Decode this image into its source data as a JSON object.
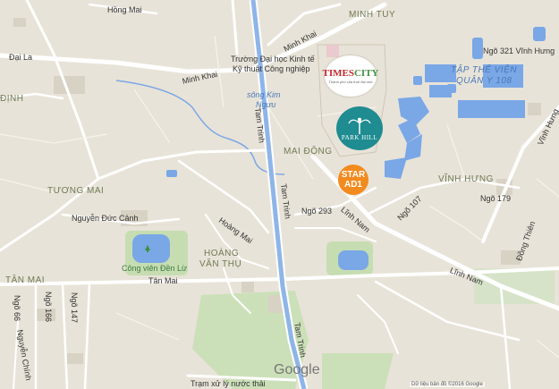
{
  "map": {
    "road_labels": {
      "hong_mai": "Hồng Mai",
      "dai_la": "Đại La",
      "minh_khai_1": "Minh Khai",
      "minh_khai_2": "Minh Khai",
      "university_line1": "Trường Đại học Kinh tế",
      "university_line2": "Kỹ thuật Công nghiệp",
      "tam_trinh_top": "Tam Trinh",
      "tam_trinh_mid": "Tam Trinh",
      "tam_trinh_bottom": "Tam Trinh",
      "ngo_321": "Ngõ 321 Vĩnh Hưng",
      "vinh_hung_road": "Vĩnh Hưng",
      "ngo_107": "Ngõ 107",
      "ngo_179": "Ngõ 179",
      "ngo_293": "Ngõ 293",
      "linh_nam_1": "Lĩnh Nam",
      "linh_nam_2": "Lĩnh Nam",
      "nguyen_duc_canh": "Nguyễn Đức Cảnh",
      "hoang_mai": "Hoàng Mai",
      "tan_mai": "Tân Mai",
      "ngo_66": "Ngõ 66",
      "ngo_166": "Ngõ 166",
      "ngo_147": "Ngõ 147",
      "nguyen_chinh": "Nguyễn Chính",
      "dong_thien": "Đồng Thiên",
      "tram_xu_ly": "Trạm xử lý nước thải"
    },
    "area_labels": {
      "minh_tuy": "MINH TUY",
      "tap_the_vien_1": "TẬP THỂ VIỆN",
      "tap_the_vien_2": "QUÂN Y 108",
      "dinh": "ĐỊNH",
      "mai_dong": "MAI ĐỘNG",
      "vinh_hung_area": "VĨNH HƯNG",
      "tuong_mai": "TƯƠNG MAI",
      "hoang_van_thu_1": "HOÀNG",
      "hoang_van_thu_2": "VĂN THỤ",
      "tan_mai_area": "TÂN MAI"
    },
    "water_labels": {
      "song_kim_nguu_1": "sông Kim",
      "song_kim_nguu_2": "Ngưu"
    },
    "park_labels": {
      "cong_vien_den_lu": "Công viên Đền Lừ"
    },
    "markers": {
      "times_city_brand": "TIMES",
      "times_city_brand2": "CITY",
      "times_city_tagline": "Thành phố của thời đại mới",
      "park_hill_left": "PARK",
      "park_hill_right": "HILL",
      "star_line1": "STAR",
      "star_line2": "AD1"
    },
    "google": "Google",
    "attribution": "Dữ liệu bản đồ ©2016 Google",
    "colors": {
      "land": "#e8e3d8",
      "major_road": "#ffffff",
      "tam_trinh_road": "#8eb5e8",
      "water": "#7aa7e6",
      "park": "#bcd7a9",
      "times_city_red": "#c0282d",
      "park_hill_teal": "#1f8c92",
      "star_orange": "#f28b1f"
    }
  }
}
